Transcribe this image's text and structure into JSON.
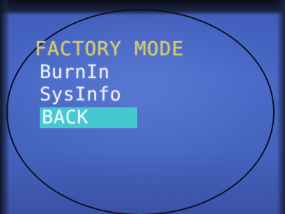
{
  "menu": {
    "title": "FACTORY MODE",
    "items": [
      {
        "label": "BurnIn",
        "selected": false
      },
      {
        "label": "SysInfo",
        "selected": false
      },
      {
        "label": "BACK",
        "selected": true
      }
    ]
  },
  "colors": {
    "background": "#4564bf",
    "title": "#d2c96f",
    "item_text": "#e6ecf8",
    "selection_highlight": "#45c8cf"
  }
}
